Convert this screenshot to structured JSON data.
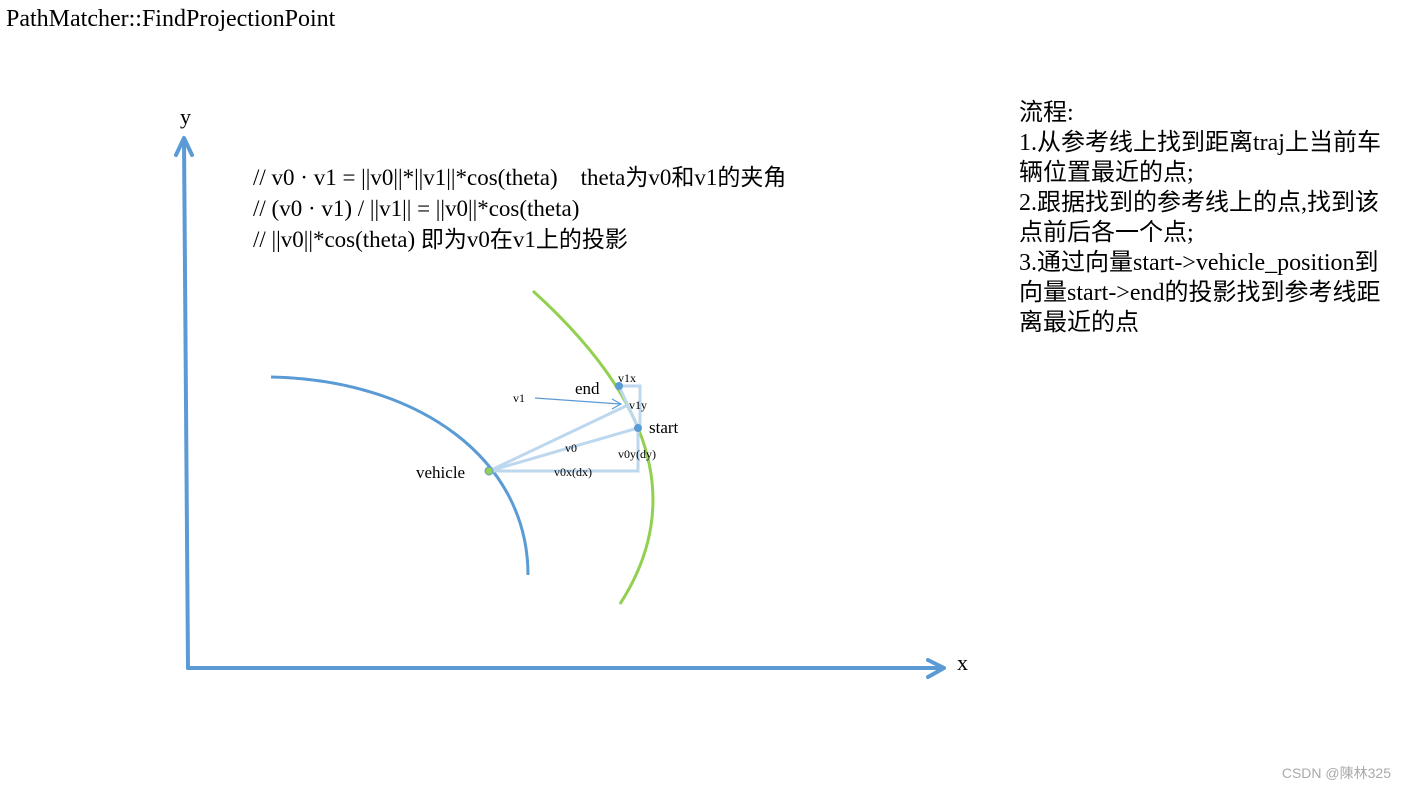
{
  "title": "PathMatcher::FindProjectionPoint",
  "formulas": [
    "// v0 · v1 = ||v0||*||v1||*cos(theta)    theta为v0和v1的夹角",
    "// (v0 · v1) / ||v1|| = ||v0||*cos(theta)",
    "// ||v0||*cos(theta) 即为v0在v1上的投影"
  ],
  "flow": {
    "heading": "流程:",
    "steps": [
      "1.从参考线上找到距离traj上当前车辆位置最近的点;",
      "2.跟据找到的参考线上的点,找到该点前后各一个点;",
      "3.通过向量start->vehicle_position到向量start->end的投影找到参考线距离最近的点"
    ]
  },
  "diagram": {
    "axis_x": "x",
    "axis_y": "y",
    "labels": {
      "end": "end",
      "start": "start",
      "vehicle": "vehicle",
      "v1": "v1",
      "v1x": "v1x",
      "v1y": "v1y",
      "v0": "v0",
      "v0x": "v0x(dx)",
      "v0y": "v0y(dy)"
    },
    "colors": {
      "axis": "#5b9bd5",
      "trajectory": "#5b9bd5",
      "reference_line": "#92d050",
      "vectors": "#bdd7ee"
    }
  },
  "watermark": "CSDN @陳林325"
}
